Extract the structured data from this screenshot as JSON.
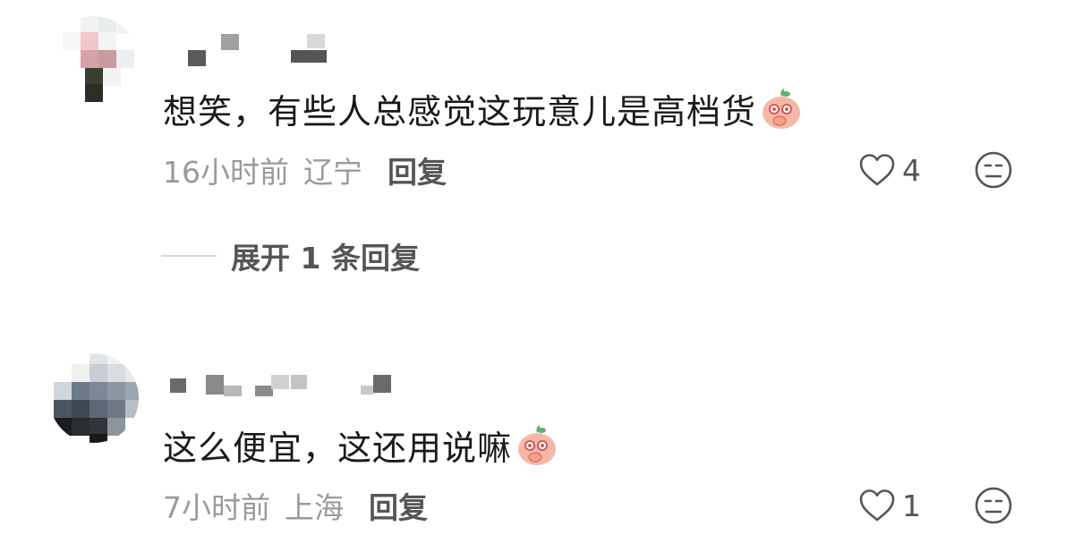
{
  "comments": [
    {
      "text": "想笑，有些人总感觉这玩意儿是高档货",
      "emoji_icon": "giggle-emoji-icon",
      "time": "16小时前",
      "location": "辽宁",
      "reply_label": "回复",
      "like_count": "4",
      "expand_label": "展开 1 条回复"
    },
    {
      "text": "这么便宜，这还用说嘛",
      "emoji_icon": "giggle-emoji-icon",
      "time": "7小时前",
      "location": "上海",
      "reply_label": "回复",
      "like_count": "1"
    }
  ],
  "icons": {
    "like": "heart-outline-icon",
    "dislike": "neutral-face-icon"
  },
  "colors": {
    "text": "#1a1a1a",
    "meta": "#9a9a9a",
    "action": "#555555",
    "divider": "#d6d6d6"
  }
}
